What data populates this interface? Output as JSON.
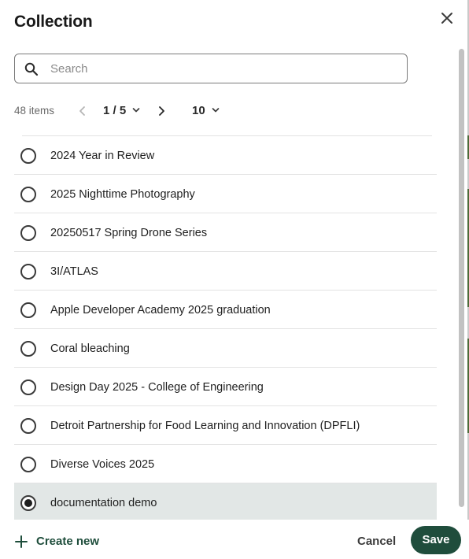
{
  "dialog": {
    "title": "Collection",
    "close_icon": "close-icon"
  },
  "search": {
    "placeholder": "Search",
    "value": "",
    "icon": "search-icon"
  },
  "pagination": {
    "count": "48 items",
    "page": "1 / 5",
    "page_size": "10",
    "prev_icon": "chevron-left-icon",
    "next_icon": "chevron-right-icon",
    "dropdown_icon": "chevron-down-icon"
  },
  "items": [
    {
      "label": "2024 Year in Review",
      "selected": false
    },
    {
      "label": "2025 Nighttime Photography",
      "selected": false
    },
    {
      "label": "20250517 Spring Drone Series",
      "selected": false
    },
    {
      "label": "3I/ATLAS",
      "selected": false
    },
    {
      "label": "Apple Developer Academy 2025 graduation",
      "selected": false
    },
    {
      "label": "Coral bleaching",
      "selected": false
    },
    {
      "label": "Design Day 2025 - College of Engineering",
      "selected": false
    },
    {
      "label": "Detroit Partnership for Food Learning and Innovation (DPFLI)",
      "selected": false
    },
    {
      "label": "Diverse Voices 2025",
      "selected": false
    },
    {
      "label": "documentation demo",
      "selected": true
    }
  ],
  "footer": {
    "create_new_label": "Create new",
    "create_new_icon": "plus-icon",
    "cancel_label": "Cancel",
    "save_label": "Save"
  },
  "colors": {
    "primary": "#1f4d3c",
    "selected_row": "#e2e7e6",
    "divider": "#e3e3e3"
  }
}
